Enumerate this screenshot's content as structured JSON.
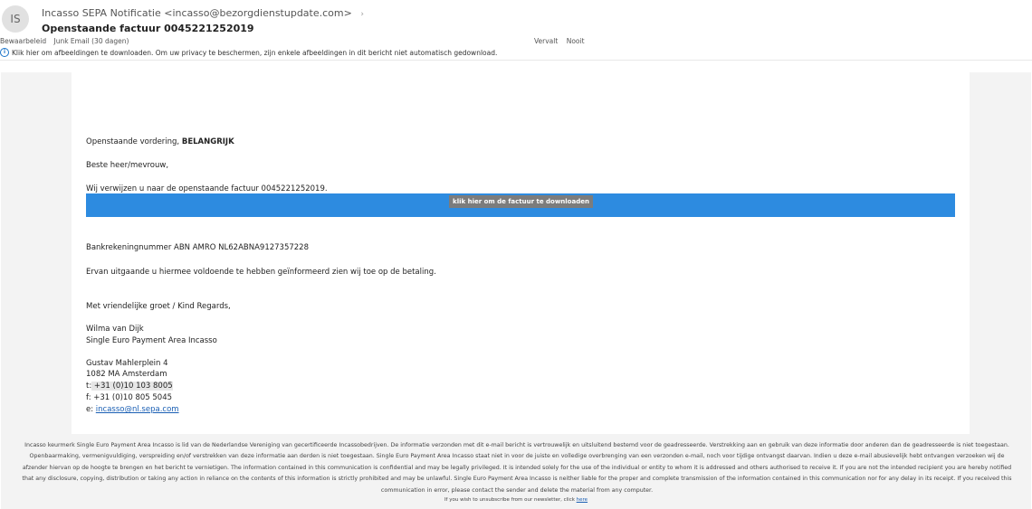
{
  "header": {
    "avatar_initials": "IS",
    "sender": "Incasso SEPA Notificatie <incasso@bezorgdienstupdate.com>",
    "subject": "Openstaande factuur 0045221252019",
    "retention_label": "Bewaarbeleid",
    "retention_value": "Junk Email (30 dagen)",
    "expires_label": "Vervalt",
    "expires_value": "Nooit",
    "info_message": "Klik hier om afbeeldingen te downloaden. Om uw privacy te beschermen, zijn enkele afbeeldingen in dit bericht niet automatisch gedownload."
  },
  "email": {
    "greeting_line_prefix": "Openstaande vordering, ",
    "greeting_line_bold": "BELANGRIJK",
    "salutation": "Beste heer/mevrouw,",
    "intro": "Wij verwijzen u naar de openstaande factuur 0045221252019.",
    "cta_label": "klik hier om de factuur te downloaden",
    "bank_line": "Bankrekeningnummer ABN AMRO NL62ABNA9127357228",
    "closing_note": "Ervan uitgaande u hiermee voldoende te hebben geïnformeerd zien wij toe op de betaling.",
    "regards": "Met vriendelijke groet / Kind Regards,",
    "name": "Wilma van Dijk",
    "organization": "Single Euro Payment Area Incasso",
    "street": "Gustav Mahlerplein 4",
    "city": "1082 MA Amsterdam",
    "phone_label": "t:",
    "phone_value": " +31 (0)10 103 8005",
    "fax": "f: +31 (0)10 805 5045",
    "email_label": "e: ",
    "email_value": "incasso@nl.sepa.com"
  },
  "footer": {
    "disclaimer": "Incasso keurmerk Single Euro Payment Area Incasso is lid van de Nederlandse Vereniging van gecertificeerde Incassobedrijven. De informatie verzonden met dit e-mail bericht is vertrouwelijk en uitsluitend bestemd voor de geadresseerde. Verstrekking aan en gebruik van deze informatie door anderen dan de geadresseerde is niet toegestaan. Openbaarmaking, vermenigvuldiging, verspreiding en/of verstrekken van deze informatie aan derden is niet toegestaan. Single Euro Payment Area Incasso staat niet in voor de juiste en volledige overbrenging van een verzonden e-mail, noch voor tijdige ontvangst daarvan. Indien u deze e-mail abusievelijk hebt ontvangen verzoeken wij de afzender hiervan op de hoogte te brengen en het bericht te vernietigen. The information contained in this communication is confidential and may be legally privileged. It is intended solely for the use of the individual or entity to whom it is addressed and others authorised to receive it. If you are not the intended recipient you are hereby notified that any disclosure, copying, distribution or taking any action in reliance on the contents of this information is strictly prohibited and may be unlawful. Single Euro Payment Area Incasso is neither liable for the proper and complete transmission of the information contained in this communication nor for any delay in its receipt. If you received this communication in error, please contact the sender and delete the material from any computer.",
    "unsubscribe_prefix": "If you wish to unsubscribe from our newsletter, click ",
    "unsubscribe_link": "here"
  }
}
